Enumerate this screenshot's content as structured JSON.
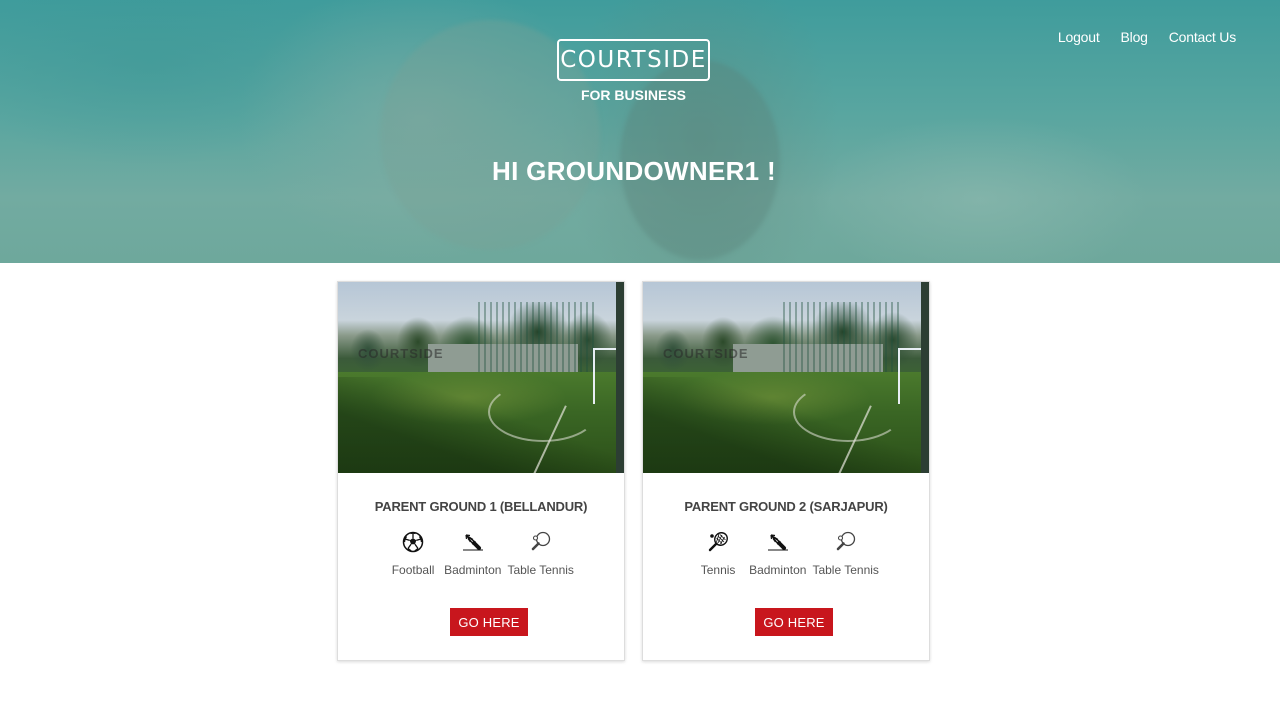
{
  "nav": {
    "items": [
      {
        "label": "Logout"
      },
      {
        "label": "Blog"
      },
      {
        "label": "Contact Us"
      }
    ]
  },
  "brand": {
    "logo_text": "COURTSIDE",
    "subtitle": "FOR BUSINESS"
  },
  "greeting": "HI GROUNDOWNER1 !",
  "colors": {
    "hero": "#5aa6a0",
    "button": "#c8161d",
    "card_border": "#dddddd"
  },
  "grounds": [
    {
      "title": "PARENT GROUND 1 (BELLANDUR)",
      "watermark": "COURTSIDE",
      "sports": [
        {
          "label": "Football",
          "icon": "football-icon"
        },
        {
          "label": "Badminton",
          "icon": "shuttlecock-icon"
        },
        {
          "label": "Table Tennis",
          "icon": "table-tennis-icon"
        }
      ],
      "button_label": "GO HERE"
    },
    {
      "title": "PARENT GROUND 2 (SARJAPUR)",
      "watermark": "COURTSIDE",
      "sports": [
        {
          "label": "Tennis",
          "icon": "tennis-racket-icon"
        },
        {
          "label": "Badminton",
          "icon": "shuttlecock-icon"
        },
        {
          "label": "Table Tennis",
          "icon": "table-tennis-icon"
        }
      ],
      "button_label": "GO HERE"
    }
  ]
}
